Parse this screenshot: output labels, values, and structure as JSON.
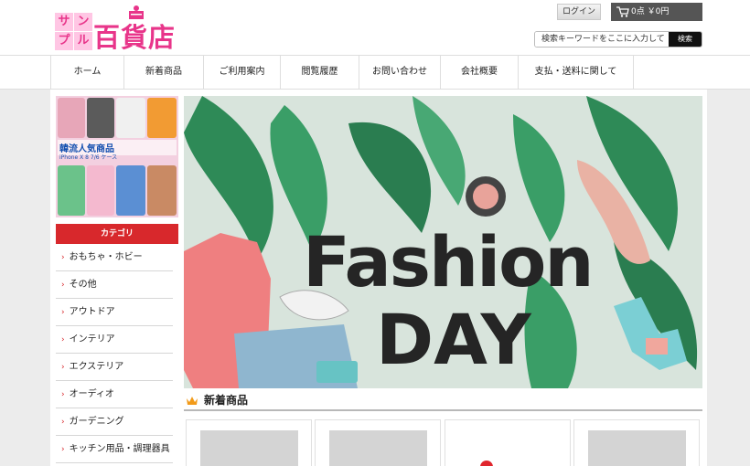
{
  "header": {
    "logo": {
      "chars": [
        "サ",
        "ン",
        "プ",
        "ル"
      ],
      "main": "百貨店"
    },
    "login_label": "ログイン",
    "cart_text": "0点 ￥0円",
    "search": {
      "placeholder": "検索キーワードをここに入力して",
      "button_label": "検索"
    }
  },
  "nav": {
    "items": [
      {
        "label": "ホーム"
      },
      {
        "label": "新着商品"
      },
      {
        "label": "ご利用案内"
      },
      {
        "label": "閲覧履歴"
      },
      {
        "label": "お問い合わせ"
      },
      {
        "label": "会社概要"
      },
      {
        "label": "支払・送料に関して"
      }
    ]
  },
  "side_banner": {
    "caption": "韓流人気商品",
    "caption_sub": "iPhone X 8 7/6 ケース"
  },
  "categories": {
    "title": "カテゴリ",
    "items": [
      {
        "label": "おもちゃ・ホビー"
      },
      {
        "label": "その他"
      },
      {
        "label": "アウトドア"
      },
      {
        "label": "インテリア"
      },
      {
        "label": "エクステリア"
      },
      {
        "label": "オーディオ"
      },
      {
        "label": "ガーデニング"
      },
      {
        "label": "キッチン用品・調理器具"
      }
    ]
  },
  "hero": {
    "line1": "Fashion",
    "line2": "DAY"
  },
  "new_items": {
    "title": "新着商品"
  },
  "colors": {
    "brand_pink": "#e8358a",
    "category_red": "#d8282c",
    "hero_bg": "#d8e4dc"
  }
}
